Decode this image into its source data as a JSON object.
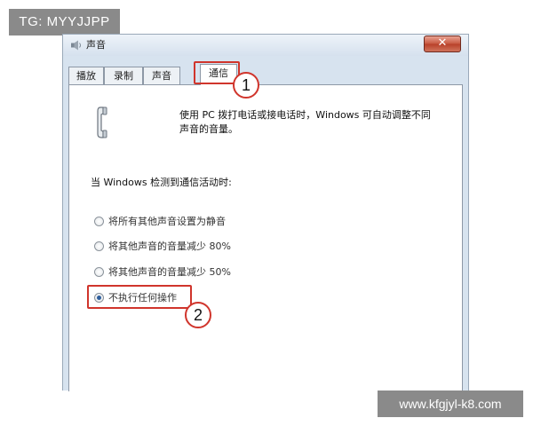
{
  "watermark": {
    "top_left": "TG: MYYJJPP",
    "bottom_right": "www.kfgjyl-k8.com"
  },
  "window": {
    "title": "声音",
    "close_icon": "close-icon"
  },
  "tabs": [
    {
      "label": "播放",
      "active": false
    },
    {
      "label": "录制",
      "active": false
    },
    {
      "label": "声音",
      "active": false
    },
    {
      "label": "通信",
      "active": true
    }
  ],
  "content": {
    "description_line1": "使用 PC 拨打电话或接电话时，Windows 可自动调整不同",
    "description_line2": "声音的音量。",
    "section_label": "当 Windows 检测到通信活动时:",
    "options": [
      {
        "label": "将所有其他声音设置为静音",
        "checked": false
      },
      {
        "label": "将其他声音的音量减少 80%",
        "checked": false
      },
      {
        "label": "将其他声音的音量减少 50%",
        "checked": false
      },
      {
        "label": "不执行任何操作",
        "checked": true
      }
    ]
  },
  "callouts": {
    "first": "1",
    "second": "2"
  },
  "colors": {
    "highlight": "#d0352c",
    "radio_dot": "#2d5e9c"
  }
}
